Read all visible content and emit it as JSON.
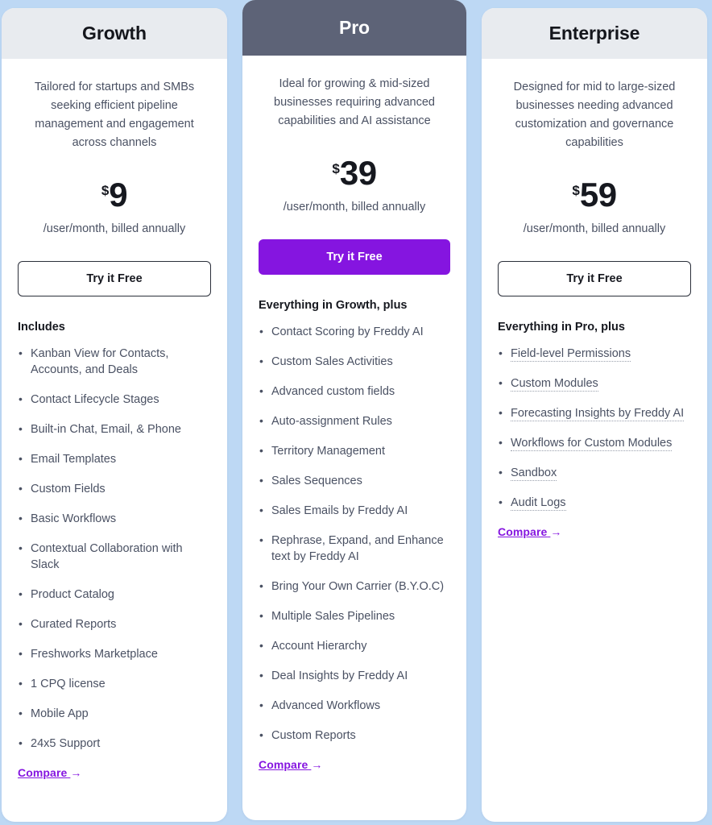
{
  "theme": {
    "page_background": "#bdd8f4",
    "card_background": "#ffffff",
    "header_light": "#e8ebef",
    "header_featured": "#5d6377",
    "accent_purple": "#8515e0",
    "text_dark": "#16181f",
    "text_muted": "#4a5163"
  },
  "plans": [
    {
      "id": "growth",
      "name": "Growth",
      "featured": false,
      "description": "Tailored for startups and SMBs seeking efficient pipeline management and engagement across channels",
      "currency": "$",
      "amount": "9",
      "billing_note": "/user/month, billed annually",
      "cta_label": "Try it Free",
      "features_title": "Includes",
      "features": [
        "Kanban View for Contacts, Accounts, and Deals",
        "Contact Lifecycle Stages",
        "Built-in Chat, Email, & Phone",
        "Email Templates",
        "Custom Fields",
        "Basic Workflows",
        "Contextual Collaboration with Slack",
        "Product Catalog",
        "Curated Reports",
        "Freshworks Marketplace",
        "1 CPQ license",
        "Mobile App",
        "24x5 Support"
      ],
      "features_tooltipped": false,
      "compare_label": "Compare",
      "compare_arrow": "→"
    },
    {
      "id": "pro",
      "name": "Pro",
      "featured": true,
      "description": "Ideal for growing & mid-sized businesses requiring advanced capabilities and AI assistance",
      "currency": "$",
      "amount": "39",
      "billing_note": "/user/month, billed annually",
      "cta_label": "Try it Free",
      "features_title": "Everything in Growth, plus",
      "features": [
        "Contact Scoring by Freddy AI",
        "Custom Sales Activities",
        "Advanced custom fields",
        "Auto-assignment Rules",
        "Territory Management",
        "Sales Sequences",
        "Sales Emails by Freddy AI",
        "Rephrase, Expand, and Enhance text by Freddy AI",
        "Bring Your Own Carrier (B.Y.O.C)",
        "Multiple Sales Pipelines",
        "Account Hierarchy",
        "Deal Insights by Freddy AI",
        "Advanced Workflows",
        "Custom Reports"
      ],
      "features_tooltipped": false,
      "compare_label": "Compare",
      "compare_arrow": "→"
    },
    {
      "id": "enterprise",
      "name": "Enterprise",
      "featured": false,
      "description": "Designed for mid to large-sized businesses needing advanced customization and governance capabilities",
      "currency": "$",
      "amount": "59",
      "billing_note": "/user/month, billed annually",
      "cta_label": "Try it Free",
      "features_title": "Everything in Pro, plus",
      "features": [
        "Field-level Permissions",
        "Custom Modules",
        "Forecasting Insights by Freddy AI",
        "Workflows for Custom Modules",
        "Sandbox",
        "Audit Logs"
      ],
      "features_tooltipped": true,
      "compare_label": "Compare",
      "compare_arrow": "→"
    }
  ]
}
